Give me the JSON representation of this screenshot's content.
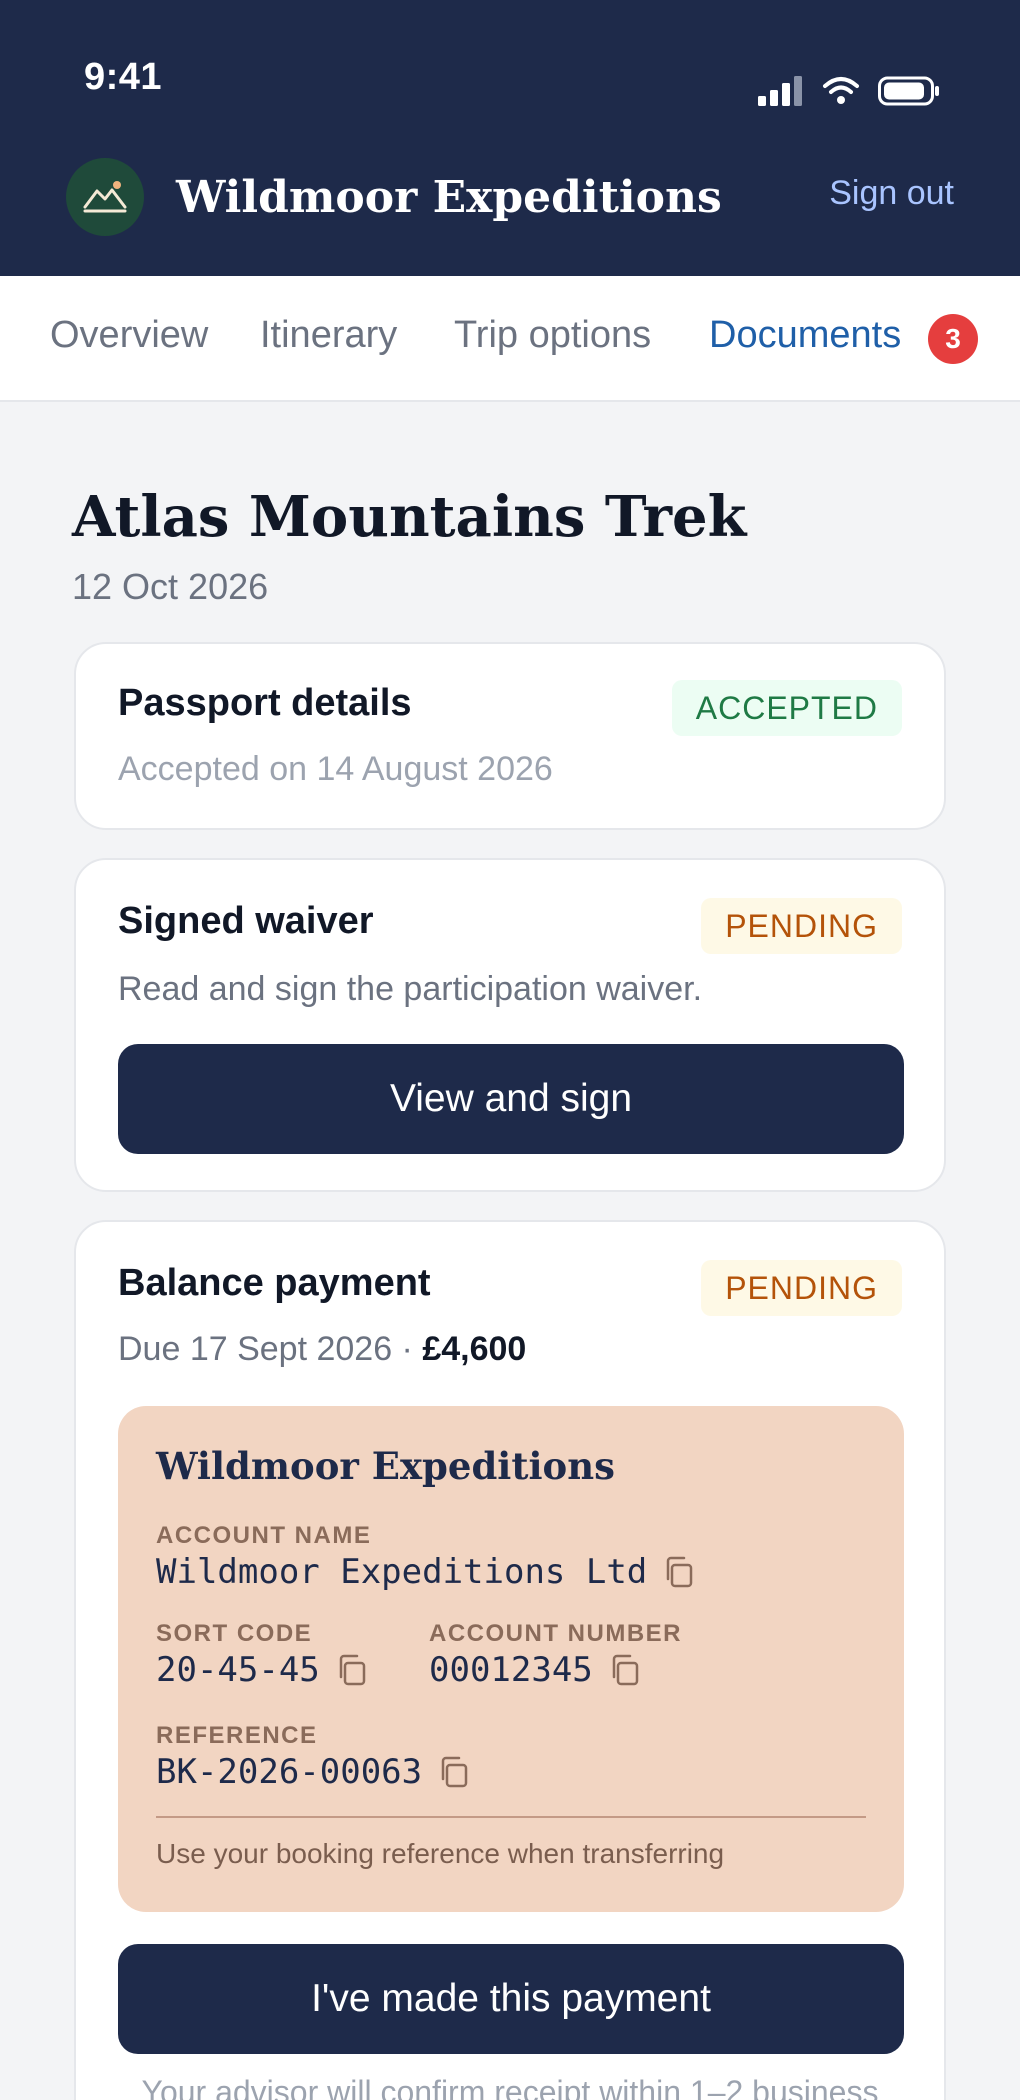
{
  "status_bar": {
    "time": "9:41"
  },
  "header": {
    "brand_name": "Wildmoor Expeditions",
    "sign_out": "Sign out",
    "logo_icon": "mountain-sun-icon"
  },
  "tabs": [
    {
      "label": "Overview"
    },
    {
      "label": "Itinerary"
    },
    {
      "label": "Trip options"
    },
    {
      "label": "Documents",
      "badge": "3",
      "active": true
    }
  ],
  "trip": {
    "title": "Atlas Mountains Trek",
    "date": "12 Oct 2026"
  },
  "documents": {
    "passport": {
      "title": "Passport details",
      "status": "ACCEPTED",
      "subtitle": "Accepted on 14 August 2026"
    },
    "waiver": {
      "title": "Signed waiver",
      "status": "PENDING",
      "subtitle": "Read and sign the participation waiver.",
      "button": "View and sign"
    },
    "balance": {
      "title": "Balance payment",
      "status": "PENDING",
      "due": "Due 17 Sept 2026 · ",
      "amount": "£4,600",
      "bank": {
        "name": "Wildmoor Expeditions",
        "account_name_label": "ACCOUNT NAME",
        "account_name": "Wildmoor Expeditions Ltd",
        "sort_code_label": "SORT CODE",
        "sort_code": "20-45-45",
        "account_number_label": "ACCOUNT NUMBER",
        "account_number": "00012345",
        "reference_label": "REFERENCE",
        "reference": "BK-2026-00063",
        "note": "Use your booking reference when transferring"
      },
      "button": "I've made this payment",
      "footnote": "Your advisor will confirm receipt within 1–2 business"
    }
  },
  "colors": {
    "navy": "#1e2a4a",
    "accent": "#1f5fa8",
    "badge": "#e53e3e",
    "accepted": "#1f7a45",
    "pending": "#b45309",
    "bank_panel": "#f2d5c2"
  }
}
